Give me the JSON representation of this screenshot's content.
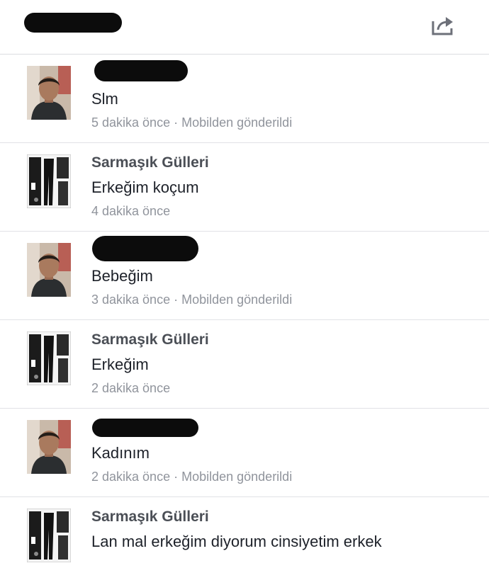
{
  "header": {
    "share_icon": "share-icon"
  },
  "messages": [
    {
      "sender": "",
      "sender_redacted": true,
      "avatar": "man-photo",
      "text": "Slm",
      "time": "5 dakika önce",
      "source": "· Mobilden gönderildi"
    },
    {
      "sender": "Sarmaşık Gülleri",
      "sender_redacted": false,
      "avatar": "clothing-collage",
      "text": "Erkeğim koçum",
      "time": "4 dakika önce",
      "source": ""
    },
    {
      "sender": "",
      "sender_redacted": true,
      "avatar": "man-photo",
      "text": "Bebeğim",
      "time": "3 dakika önce",
      "source": "· Mobilden gönderildi"
    },
    {
      "sender": "Sarmaşık Gülleri",
      "sender_redacted": false,
      "avatar": "clothing-collage",
      "text": "Erkeğim",
      "time": "2 dakika önce",
      "source": ""
    },
    {
      "sender": "",
      "sender_redacted": true,
      "avatar": "man-photo",
      "text": "Kadınım",
      "time": "2 dakika önce",
      "source": "· Mobilden gönderildi"
    },
    {
      "sender": "Sarmaşık Gülleri",
      "sender_redacted": false,
      "avatar": "clothing-collage",
      "text": "Lan mal erkeğim diyorum cinsiyetim erkek",
      "time": "",
      "source": ""
    }
  ]
}
